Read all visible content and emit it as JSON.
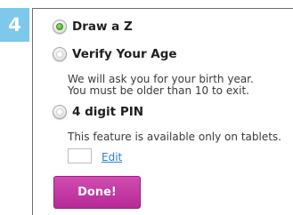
{
  "step": {
    "number": "4"
  },
  "options": [
    {
      "label": "Draw a Z",
      "selected": true
    },
    {
      "label": "Verify Your Age",
      "selected": false,
      "description": [
        "We will ask you for your birth year.",
        "You must be older than 10 to exit."
      ]
    },
    {
      "label": "4 digit PIN",
      "selected": false,
      "description": [
        "This feature is available only on tablets."
      ]
    }
  ],
  "pin": {
    "value": "",
    "edit_label": "Edit"
  },
  "done_label": "Done!",
  "colors": {
    "step_badge": "#7ec8ec",
    "done_button": "#c43aa4",
    "selected_radio": "#54b331",
    "link": "#2a7fd4"
  },
  "icons": {
    "radio_checked": "radio-checked-icon",
    "radio_unchecked": "radio-unchecked-icon"
  }
}
